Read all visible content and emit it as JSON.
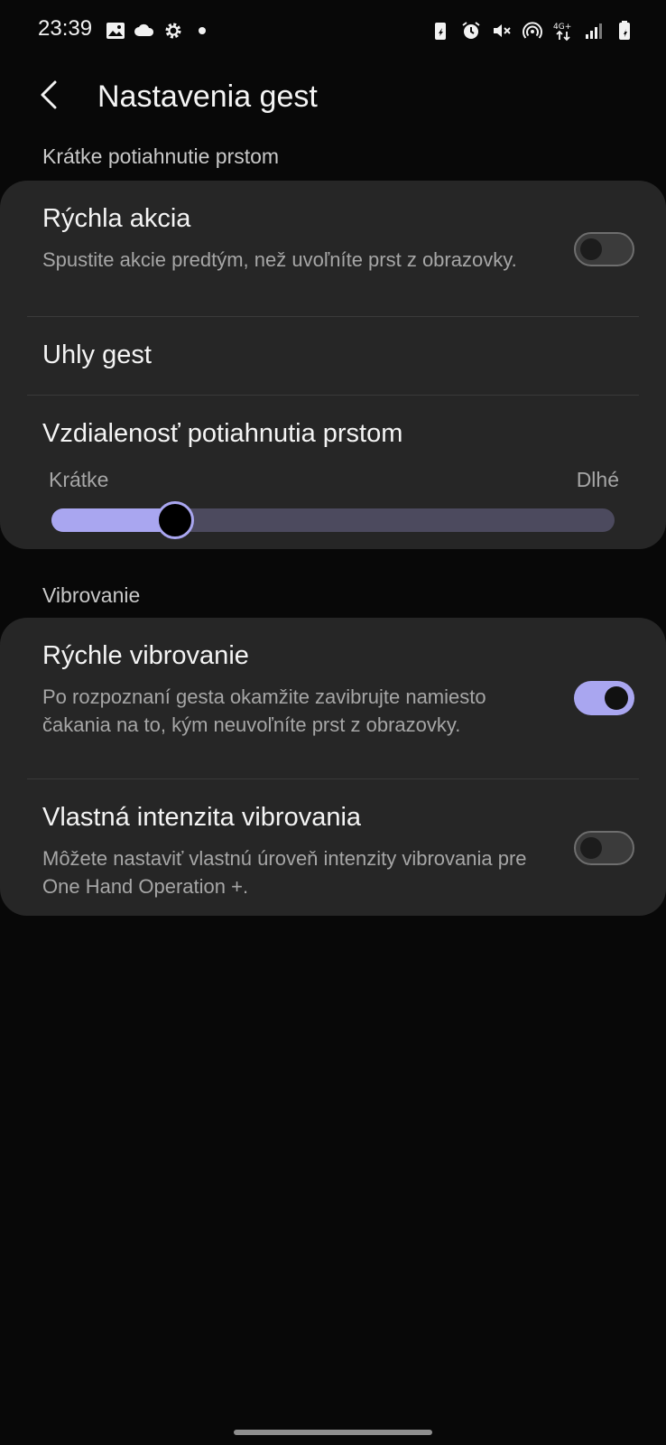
{
  "status_bar": {
    "time": "23:39",
    "left_icons": [
      "image-icon",
      "cloud-icon",
      "gear-icon",
      "dot-icon"
    ],
    "right_icons": [
      "battery-saver-icon",
      "alarm-icon",
      "mute-icon",
      "hotspot-icon",
      "network-4g-icon",
      "signal-icon",
      "battery-icon"
    ],
    "network_label": "4G+"
  },
  "header": {
    "title": "Nastavenia gest"
  },
  "sections": {
    "swipe": {
      "label": "Krátke potiahnutie prstom",
      "quick_action": {
        "title": "Rýchla akcia",
        "subtitle": "Spustite akcie predtým, než uvoľníte prst z obrazovky.",
        "enabled": false
      },
      "gesture_angles": {
        "title": "Uhly gest"
      },
      "swipe_distance": {
        "title": "Vzdialenosť potiahnutia prstom",
        "min_label": "Krátke",
        "max_label": "Dlhé",
        "value_fraction": 0.2
      }
    },
    "vibration": {
      "label": "Vibrovanie",
      "quick_vibration": {
        "title": "Rýchle vibrovanie",
        "subtitle": "Po rozpoznaní gesta okamžite zavibrujte namiesto čakania na to, kým neuvoľníte prst z obrazovky.",
        "enabled": true
      },
      "custom_intensity": {
        "title": "Vlastná intenzita vibrovania",
        "subtitle": "Môžete nastaviť vlastnú úroveň intenzity vibrovania pre One Hand Operation +.",
        "enabled": false
      }
    }
  },
  "colors": {
    "accent": "#a9a6f0",
    "card": "#262626",
    "background": "#080808"
  }
}
